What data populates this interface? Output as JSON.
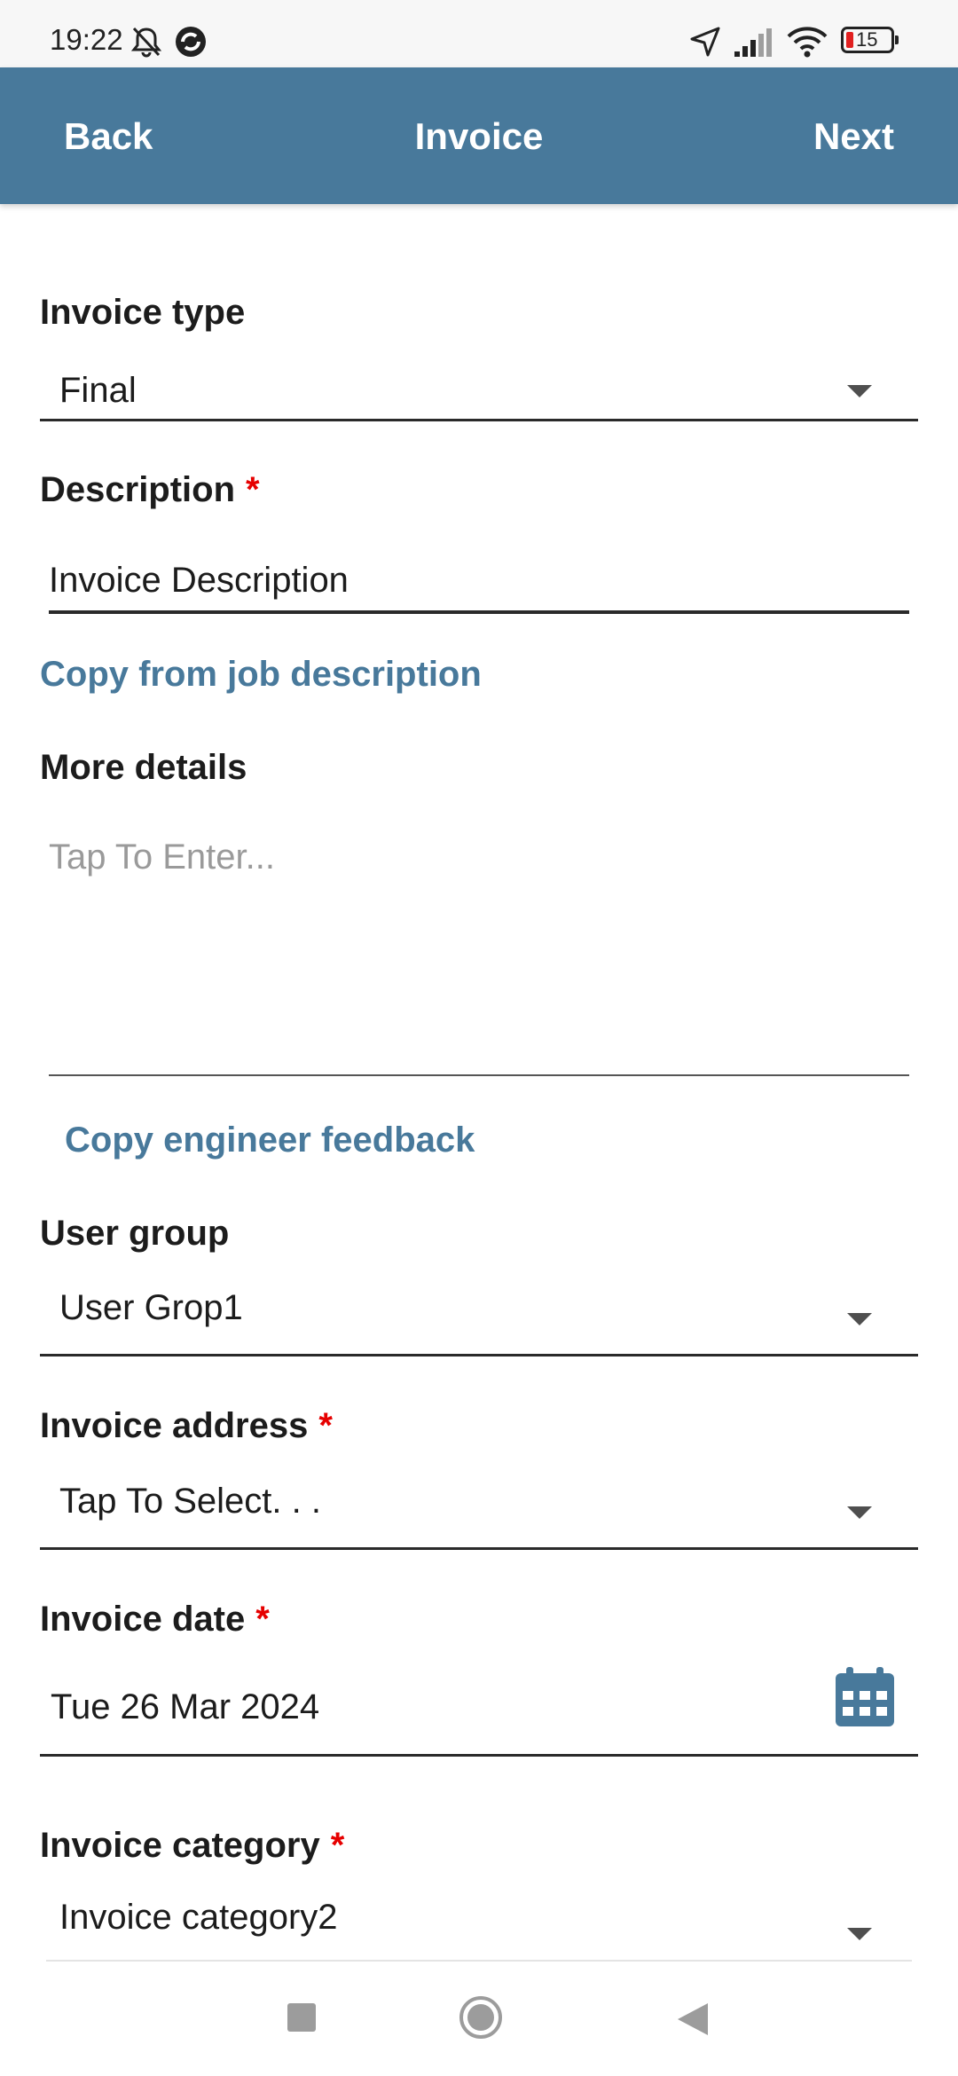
{
  "status_bar": {
    "time": "19:22",
    "battery": "15",
    "icons": [
      "mute-icon",
      "app-sync-icon",
      "location-arrow-icon",
      "signal-icon",
      "wifi-icon",
      "battery-icon"
    ]
  },
  "header": {
    "back_label": "Back",
    "title": "Invoice",
    "next_label": "Next",
    "color": "#48799b"
  },
  "form": {
    "invoice_type": {
      "label": "Invoice type",
      "value": "Final"
    },
    "description": {
      "label": "Description",
      "required_mark": "*",
      "value": "Invoice Description"
    },
    "copy_job_description": "Copy from job description",
    "more_details": {
      "label": "More details",
      "placeholder": "Tap To Enter..."
    },
    "copy_engineer_feedback": "Copy engineer feedback",
    "user_group": {
      "label": "User group",
      "value": "User Grop1"
    },
    "invoice_address": {
      "label": "Invoice address",
      "required_mark": "*",
      "placeholder": "Tap To Select. . ."
    },
    "invoice_date": {
      "label": "Invoice date",
      "required_mark": "*",
      "value": "Tue 26 Mar 2024"
    },
    "invoice_category": {
      "label": "Invoice category",
      "required_mark": "*",
      "value": "Invoice category2"
    }
  },
  "nav_bar": {
    "icons": [
      "recents-square-icon",
      "home-circle-icon",
      "back-triangle-icon"
    ]
  }
}
